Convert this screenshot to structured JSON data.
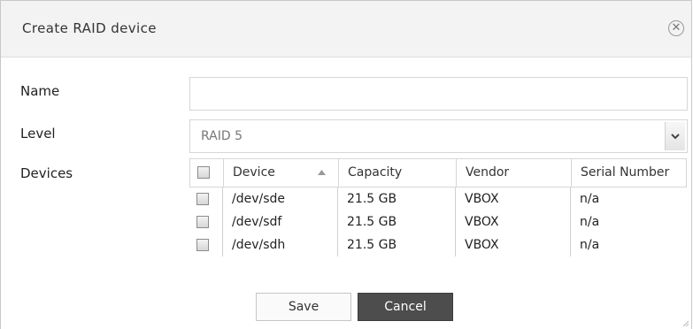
{
  "dialog": {
    "title": "Create RAID device",
    "close_icon": "close-circle-icon"
  },
  "form": {
    "name_label": "Name",
    "name_value": "",
    "name_placeholder": "",
    "level_label": "Level",
    "level_value": "RAID 5",
    "devices_label": "Devices"
  },
  "devices_table": {
    "columns": [
      "Device",
      "Capacity",
      "Vendor",
      "Serial Number"
    ],
    "sort_column": "Device",
    "rows": [
      {
        "device": "/dev/sde",
        "capacity": "21.5 GB",
        "vendor": "VBOX",
        "serial": "n/a",
        "checked": false
      },
      {
        "device": "/dev/sdf",
        "capacity": "21.5 GB",
        "vendor": "VBOX",
        "serial": "n/a",
        "checked": false
      },
      {
        "device": "/dev/sdh",
        "capacity": "21.5 GB",
        "vendor": "VBOX",
        "serial": "n/a",
        "checked": false
      }
    ]
  },
  "buttons": {
    "save": "Save",
    "cancel": "Cancel"
  },
  "colors": {
    "header_bg": "#f3f3f3",
    "cancel_bg": "#4d4d4d",
    "border": "#d6d6d6"
  }
}
